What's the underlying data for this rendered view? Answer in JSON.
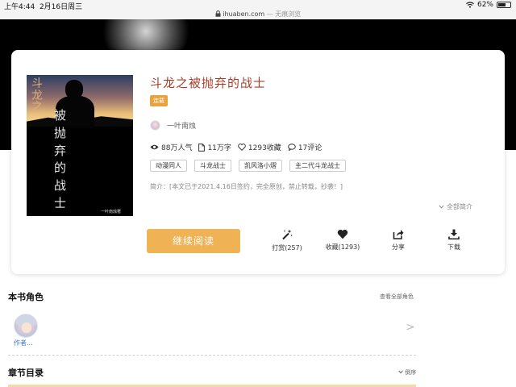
{
  "status_bar": {
    "time": "上午4:44",
    "date": "2月16日周三",
    "url": "ihuaben.com",
    "url_suffix": "— 无痕浏览",
    "battery": "62%",
    "battery_level": 0.62
  },
  "book": {
    "title": "斗龙之被抛弃的战士",
    "status_badge": "连载",
    "cover_title_left": "斗龙之",
    "cover_title_right": "被抛弃的战士",
    "cover_author": "一叶南烛著",
    "author": "一叶南烛",
    "stats": {
      "popularity": "88万人气",
      "words": "11万字",
      "favorites": "1293收藏",
      "comments": "17评论"
    },
    "tags": [
      "动漫同人",
      "斗龙战士",
      "凯风洛小熠",
      "主二代斗龙战士"
    ],
    "summary": "简介：[本文已于2021.4.16日签约，完全原创，禁止转载，抄袭！]",
    "expand_label": "全部简介",
    "continue_reading": "继续阅读",
    "actions": {
      "tip": "打赏(257)",
      "favorite": "收藏(1293)",
      "share": "分享",
      "download": "下载"
    }
  },
  "roles": {
    "title": "本书角色",
    "view_all": "查看全部角色",
    "items": [
      {
        "name": "作者..."
      }
    ]
  },
  "toc": {
    "title": "章节目录",
    "sort_label": "倒序"
  },
  "colors": {
    "title": "#a63d2a",
    "accent": "#efb255",
    "badge": "#e8a33f",
    "banner": "#000000"
  },
  "icons": {
    "wifi": "wifi-icon",
    "lock": "lock-icon",
    "eye": "eye-icon",
    "doc": "document-icon",
    "heart": "heart-icon",
    "comment": "comment-icon",
    "wand": "magic-wand-icon",
    "share": "share-icon",
    "download": "download-icon",
    "chevron": "chevron-right-icon"
  }
}
